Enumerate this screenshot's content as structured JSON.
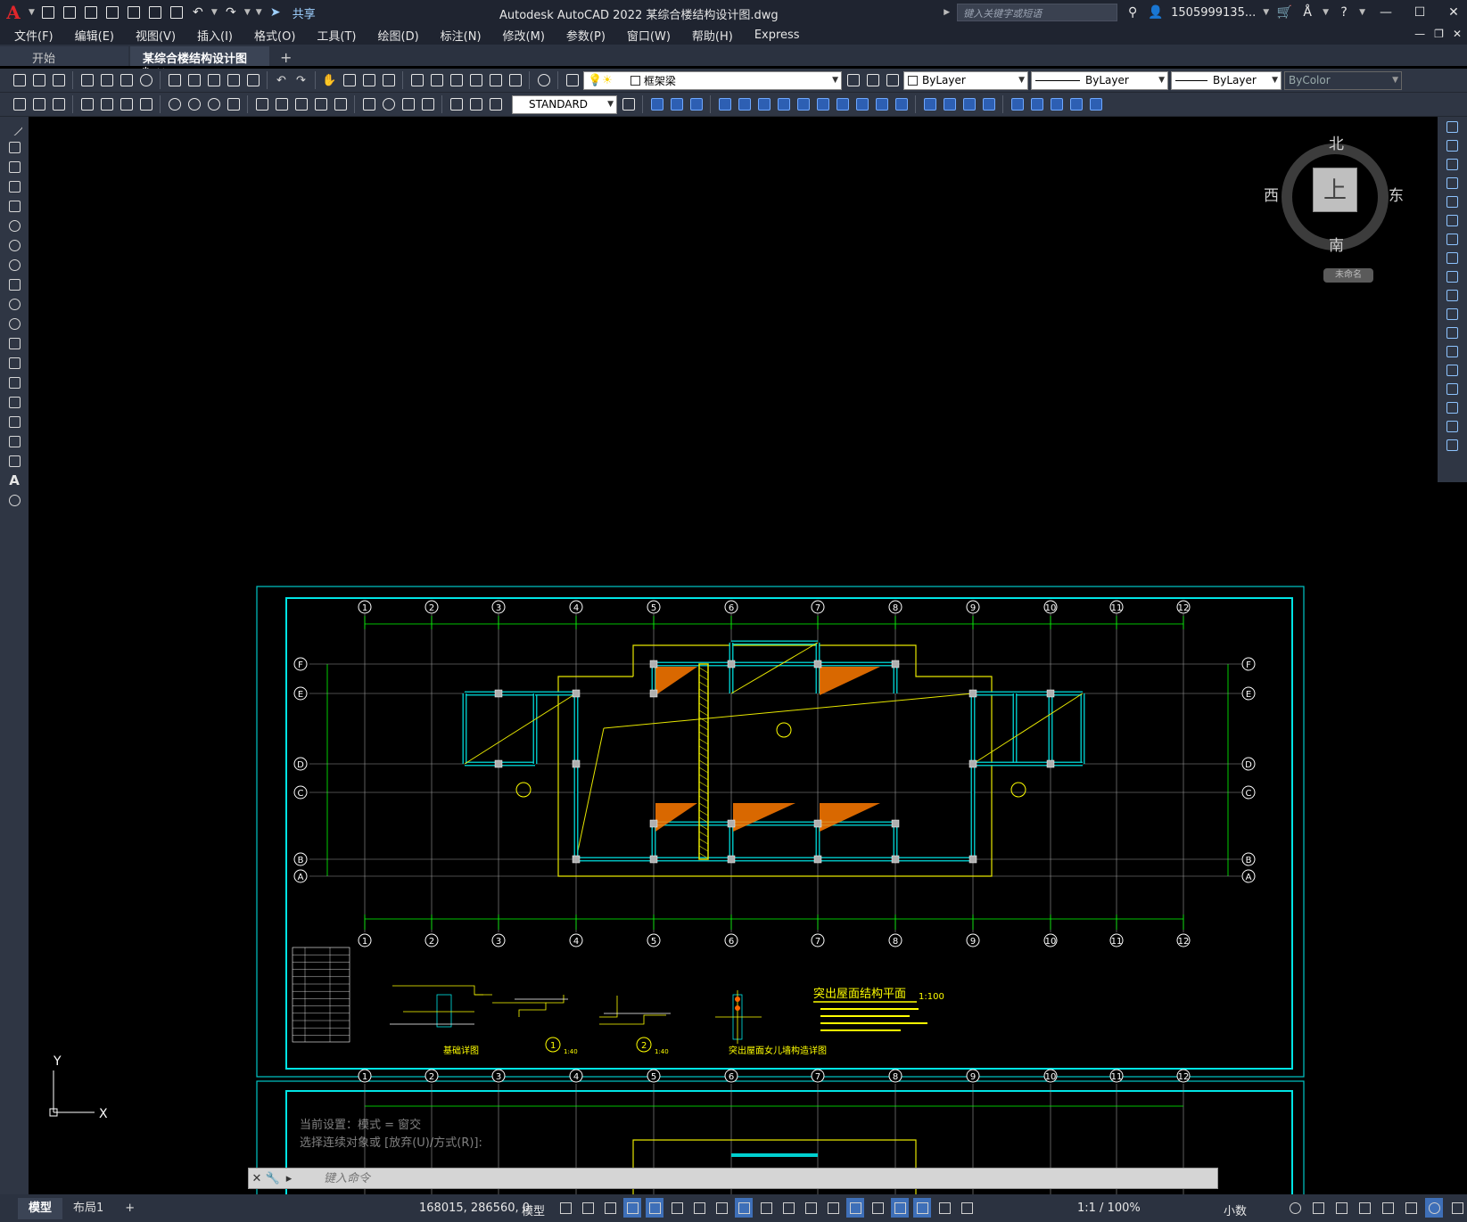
{
  "app": {
    "title": "Autodesk AutoCAD 2022    某综合楼结构设计图.dwg",
    "share_label": "共享",
    "search_placeholder": "键入关键字或短语",
    "user": "1505999135...",
    "window_controls": [
      "—",
      "☐",
      "✕"
    ]
  },
  "menu": [
    "文件(F)",
    "编辑(E)",
    "视图(V)",
    "插入(I)",
    "格式(O)",
    "工具(T)",
    "绘图(D)",
    "标注(N)",
    "修改(M)",
    "参数(P)",
    "窗口(W)",
    "帮助(H)",
    "Express"
  ],
  "tabs": {
    "start": "开始",
    "active": "某综合楼结构设计图*",
    "close": "✕",
    "add": "+"
  },
  "toolbar": {
    "layer": "框架梁",
    "color": "ByLayer",
    "linetype": "ByLayer",
    "lineweight": "ByLayer",
    "plotstyle": "ByColor",
    "textstyle": "STANDARD"
  },
  "viewcube": {
    "north": "北",
    "south": "南",
    "east": "东",
    "west": "西",
    "face": "上",
    "ucs": "未命名"
  },
  "ucs_icon": {
    "y": "Y",
    "x": "X"
  },
  "drawing": {
    "axes_numbers": [
      "①",
      "②",
      "③",
      "④",
      "⑤",
      "⑥",
      "⑦",
      "⑧",
      "⑨",
      "⑩",
      "⑪",
      "⑫"
    ],
    "axes_letters": [
      "Ⓕ",
      "Ⓔ",
      "Ⓓ",
      "Ⓒ",
      "Ⓑ",
      "Ⓐ"
    ],
    "plan_title": "突出屋面结构平面",
    "plan_scale": "1:100",
    "detail_1_title": "基础详图",
    "detail_2_title": "突出屋面女儿墙构造详图",
    "detail_markers": [
      "1",
      "2"
    ],
    "detail_scale": "1:40"
  },
  "command": {
    "history": [
      "当前设置：模式 = 窗交",
      "选择连续对象或 [放弃(U)/方式(R)]:"
    ],
    "placeholder": "键入命令"
  },
  "status": {
    "layouts": [
      "模型",
      "布局1"
    ],
    "add_layout": "+",
    "coords": "168015, 286560, 0",
    "model": "模型",
    "scale": "1:1 / 100%",
    "units": "小数"
  }
}
